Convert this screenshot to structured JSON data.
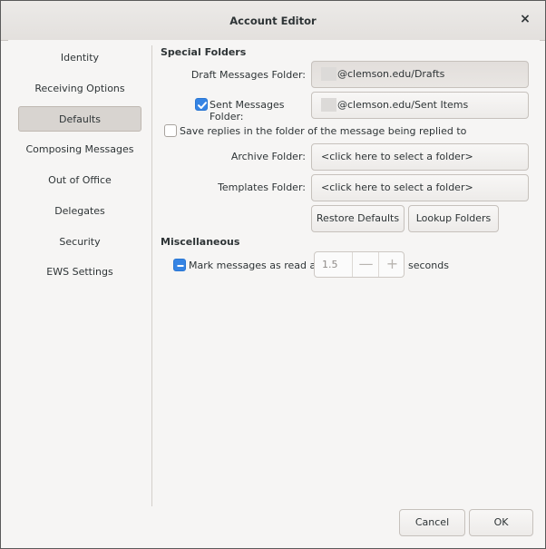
{
  "window": {
    "title": "Account Editor",
    "close_symbol": "×"
  },
  "sidebar": {
    "items": [
      {
        "label": "Identity",
        "selected": false
      },
      {
        "label": "Receiving Options",
        "selected": false
      },
      {
        "label": "Defaults",
        "selected": true
      },
      {
        "label": "Composing Messages",
        "selected": false
      },
      {
        "label": "Out of Office",
        "selected": false
      },
      {
        "label": "Delegates",
        "selected": false
      },
      {
        "label": "Security",
        "selected": false
      },
      {
        "label": "EWS Settings",
        "selected": false
      }
    ]
  },
  "special_folders": {
    "title": "Special Folders",
    "draft_label": "Draft Messages Folder:",
    "draft_value": "@clemson.edu/Drafts",
    "sent_label": "Sent Messages Folder:",
    "sent_checked": true,
    "sent_value": "@clemson.edu/Sent Items",
    "save_replies_label": "Save replies in the folder of the message being replied to",
    "save_replies_checked": false,
    "archive_label": "Archive Folder:",
    "archive_value": "<click here to select a folder>",
    "templates_label": "Templates Folder:",
    "templates_value": "<click here to select a folder>",
    "restore_defaults": "Restore Defaults",
    "lookup_folders": "Lookup Folders"
  },
  "misc": {
    "title": "Miscellaneous",
    "mark_read_label": "Mark messages as read after",
    "mark_read_state": "indeterminate",
    "mark_read_value": "1.5",
    "minus_symbol": "—",
    "plus_symbol": "+",
    "seconds_label": "seconds"
  },
  "footer": {
    "cancel": "Cancel",
    "ok": "OK"
  },
  "colors": {
    "accent": "#3584e4",
    "selected_bg": "#d8d4d0",
    "window_bg": "#f6f5f4"
  }
}
